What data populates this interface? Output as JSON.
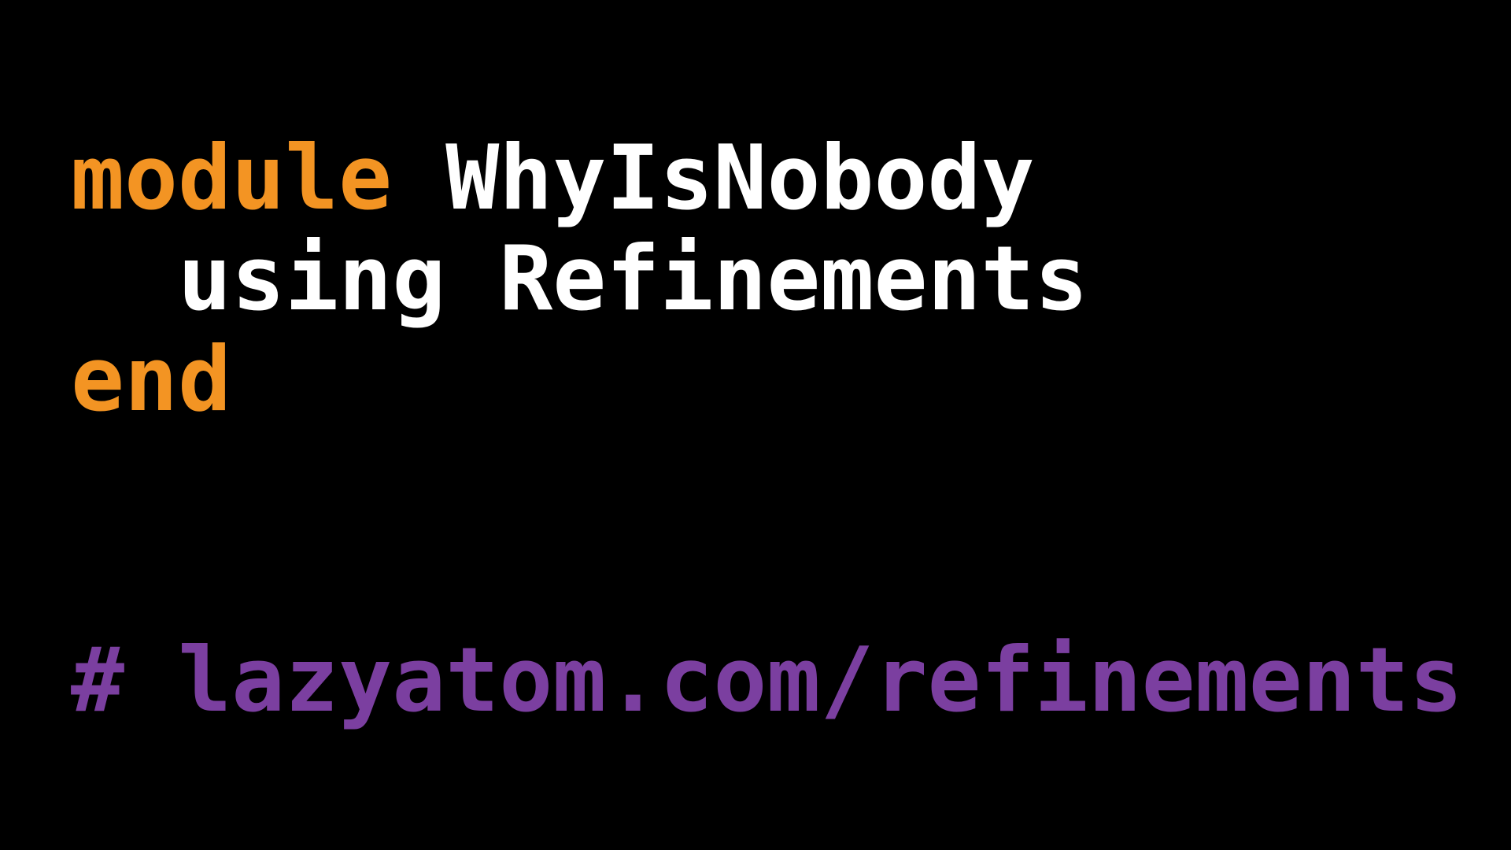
{
  "code": {
    "line1": {
      "keyword": "module",
      "space": " ",
      "name": "WhyIsNobody"
    },
    "line2": {
      "indent": "  ",
      "text": "using Refinements"
    },
    "line3": {
      "keyword": "end"
    },
    "comment": "# lazyatom.com/refinements"
  },
  "colors": {
    "background": "#000000",
    "keyword": "#F39423",
    "plain": "#FFFFFF",
    "comment": "#7B3FA0"
  }
}
